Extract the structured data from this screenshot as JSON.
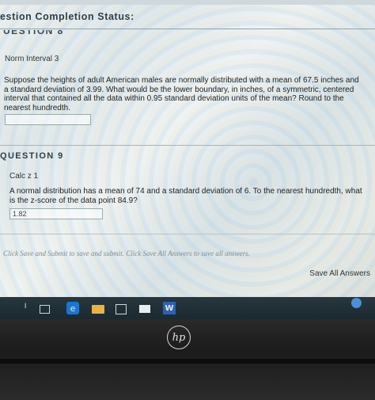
{
  "status": {
    "title": "estion Completion Status:"
  },
  "question8": {
    "header": "UESTION 8",
    "sub_label": "Norm Interval 3",
    "text_lines": [
      "Suppose the heights of adult American males are normally distributed with a mean of 67.5 inches and",
      "a standard deviation of 3.99. What would be the lower boundary, in inches, of a symmetric, centered",
      "interval that contained all the data within 0.95 standard deviation units of the mean? Round to the",
      "nearest hundredth."
    ],
    "answer_value": ""
  },
  "question9": {
    "header": "QUESTION 9",
    "sub_label": "Calc z 1",
    "text_lines": [
      "A normal distribution has a mean of 74 and a standard deviation of 6. To the nearest hundredth, what",
      "is the z-score of the data point 84.9?"
    ],
    "answer_value": "1.82"
  },
  "footer": {
    "instruction": "Click Save and Submit to save and submit. Click Save All Answers to save all answers.",
    "save_all_label": "Save All Answers"
  },
  "taskbar": {
    "icons": [
      "microphone-icon",
      "task-view-icon",
      "edge-browser-icon",
      "file-explorer-icon",
      "store-icon",
      "mail-icon",
      "word-icon",
      "chrome-icon"
    ]
  },
  "laptop": {
    "logo": "hp"
  }
}
